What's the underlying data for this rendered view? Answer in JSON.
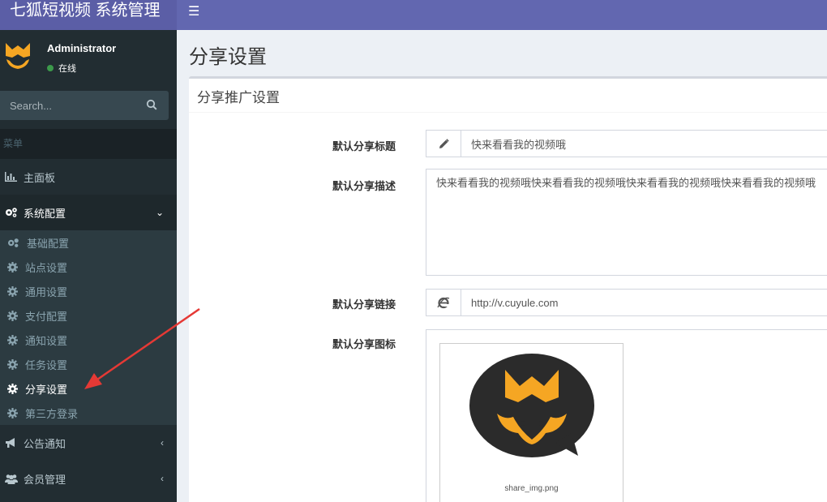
{
  "app": {
    "title": "七狐短视频 系统管理"
  },
  "user": {
    "name": "Administrator",
    "status": "在线"
  },
  "search": {
    "placeholder": "Search..."
  },
  "sidebar": {
    "menu_header": "菜单",
    "dashboard": "主面板",
    "system_config": "系统配置",
    "submenu": [
      "基础配置",
      "站点设置",
      "通用设置",
      "支付配置",
      "通知设置",
      "任务设置",
      "分享设置",
      "第三方登录"
    ],
    "active_index": 6,
    "notice": "公告通知",
    "member": "会员管理"
  },
  "page": {
    "title": "分享设置"
  },
  "box": {
    "title": "分享推广设置"
  },
  "form": {
    "share_title_label": "默认分享标题",
    "share_title_value": "快来看看我的视频哦",
    "share_desc_label": "默认分享描述",
    "share_desc_value": "快来看看我的视频哦快来看看我的视频哦快来看看我的视频哦快来看看我的视频哦",
    "share_link_label": "默认分享链接",
    "share_link_value": "http://v.cuyule.com",
    "share_icon_label": "默认分享图标",
    "share_icon_filename": "share_img.png"
  },
  "colors": {
    "header": "#6267b0",
    "sidebar": "#222d32",
    "accent": "#f5a623",
    "annotation_arrow": "#e53935"
  }
}
